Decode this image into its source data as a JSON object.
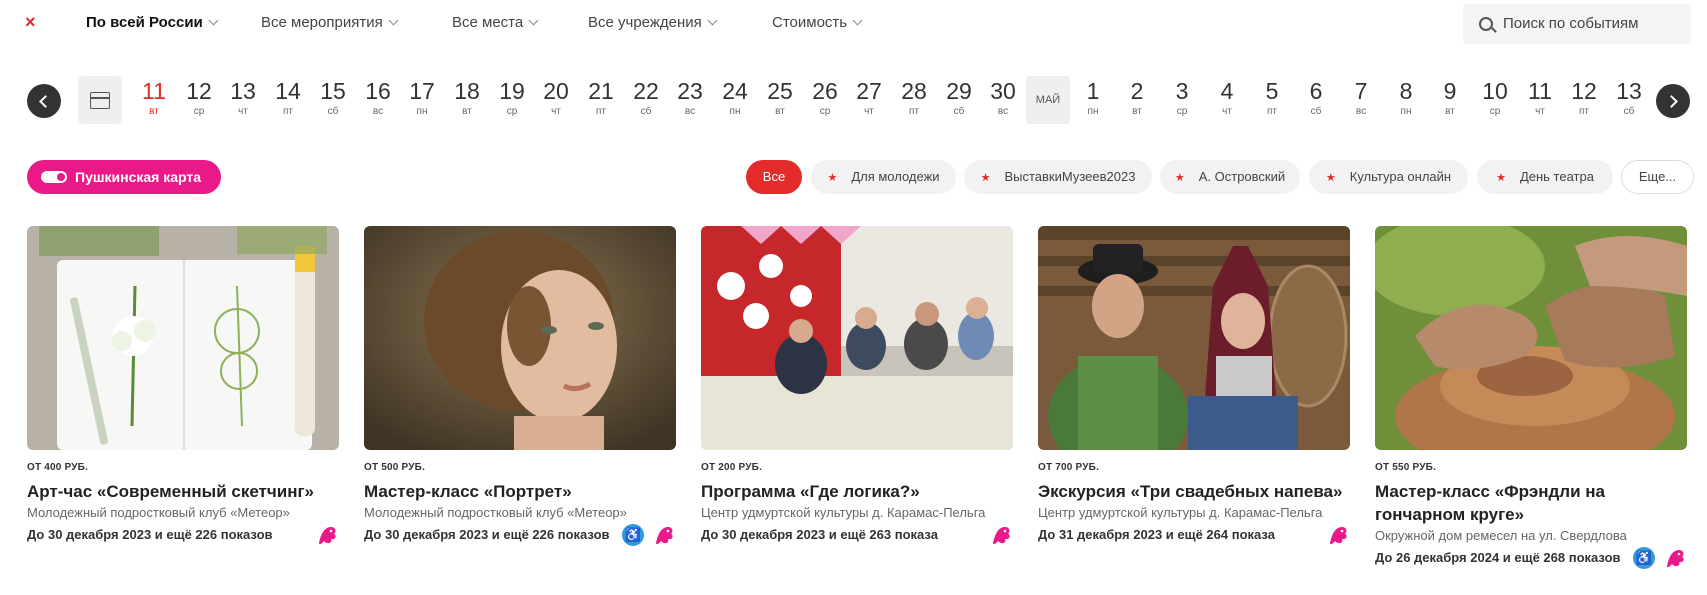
{
  "filters": {
    "close": "×",
    "region": "По всей России",
    "events": "Все мероприятия",
    "places": "Все места",
    "institutions": "Все учреждения",
    "price": "Стоимость",
    "search_placeholder": "Поиск по событиям"
  },
  "calendar": {
    "month_label": "МАЙ",
    "days_before": [
      {
        "num": "11",
        "wd": "вт",
        "today": true
      },
      {
        "num": "12",
        "wd": "ср"
      },
      {
        "num": "13",
        "wd": "чт"
      },
      {
        "num": "14",
        "wd": "пт"
      },
      {
        "num": "15",
        "wd": "сб"
      },
      {
        "num": "16",
        "wd": "вс"
      },
      {
        "num": "17",
        "wd": "пн"
      },
      {
        "num": "18",
        "wd": "вт"
      },
      {
        "num": "19",
        "wd": "ср"
      },
      {
        "num": "20",
        "wd": "чт"
      },
      {
        "num": "21",
        "wd": "пт"
      },
      {
        "num": "22",
        "wd": "сб"
      },
      {
        "num": "23",
        "wd": "вс"
      },
      {
        "num": "24",
        "wd": "пн"
      },
      {
        "num": "25",
        "wd": "вт"
      },
      {
        "num": "26",
        "wd": "ср"
      },
      {
        "num": "27",
        "wd": "чт"
      },
      {
        "num": "28",
        "wd": "пт"
      },
      {
        "num": "29",
        "wd": "сб"
      },
      {
        "num": "30",
        "wd": "вс"
      }
    ],
    "days_after": [
      {
        "num": "1",
        "wd": "пн"
      },
      {
        "num": "2",
        "wd": "вт"
      },
      {
        "num": "3",
        "wd": "ср"
      },
      {
        "num": "4",
        "wd": "чт"
      },
      {
        "num": "5",
        "wd": "пт"
      },
      {
        "num": "6",
        "wd": "сб"
      },
      {
        "num": "7",
        "wd": "вс"
      },
      {
        "num": "8",
        "wd": "пн"
      },
      {
        "num": "9",
        "wd": "вт"
      },
      {
        "num": "10",
        "wd": "ср"
      },
      {
        "num": "11",
        "wd": "чт"
      },
      {
        "num": "12",
        "wd": "пт"
      },
      {
        "num": "13",
        "wd": "сб"
      }
    ]
  },
  "pushkin_card": "Пушкинская карта",
  "tags": {
    "all": "Все",
    "items": [
      "Для молодежи",
      "ВыставкиМузеев2023",
      "А. Островский",
      "Культура онлайн",
      "День театра"
    ],
    "more": "Еще..."
  },
  "events": [
    {
      "price": "ОТ 400 РУБ.",
      "title": "Арт-час «Современный скетчинг»",
      "place": "Молодежный подростковый клуб «Метеор»",
      "dates": "До 30 декабря 2023 и ещё 226 показов",
      "accessible": false
    },
    {
      "price": "ОТ 500 РУБ.",
      "title": "Мастер-класс «Портрет»",
      "place": "Молодежный подростковый клуб «Метеор»",
      "dates": "До 30 декабря 2023 и ещё 226 показов",
      "accessible": true
    },
    {
      "price": "ОТ 200 РУБ.",
      "title": "Программа «Где логика?»",
      "place": "Центр удмуртской культуры д. Карамас-Пельга",
      "dates": "До 30 декабря 2023 и ещё 263 показа",
      "accessible": false
    },
    {
      "price": "ОТ 700 РУБ.",
      "title": "Экскурсия «Три свадебных напева»",
      "place": "Центр удмуртской культуры д. Карамас-Пельга",
      "dates": "До 31 декабря 2023 и ещё 264 показа",
      "accessible": false
    },
    {
      "price": "ОТ 550 РУБ.",
      "title": "Мастер-класс «Фрэндли на гончарном круге»",
      "place": "Окружной дом ремесел на ул. Свердлова",
      "dates": "До 26 декабря 2024 и ещё 268 показов",
      "accessible": true
    }
  ],
  "colors": {
    "accent_red": "#e32b2b",
    "pushkin_pink": "#e9198a",
    "accessibility_blue": "#2f9bd9"
  }
}
